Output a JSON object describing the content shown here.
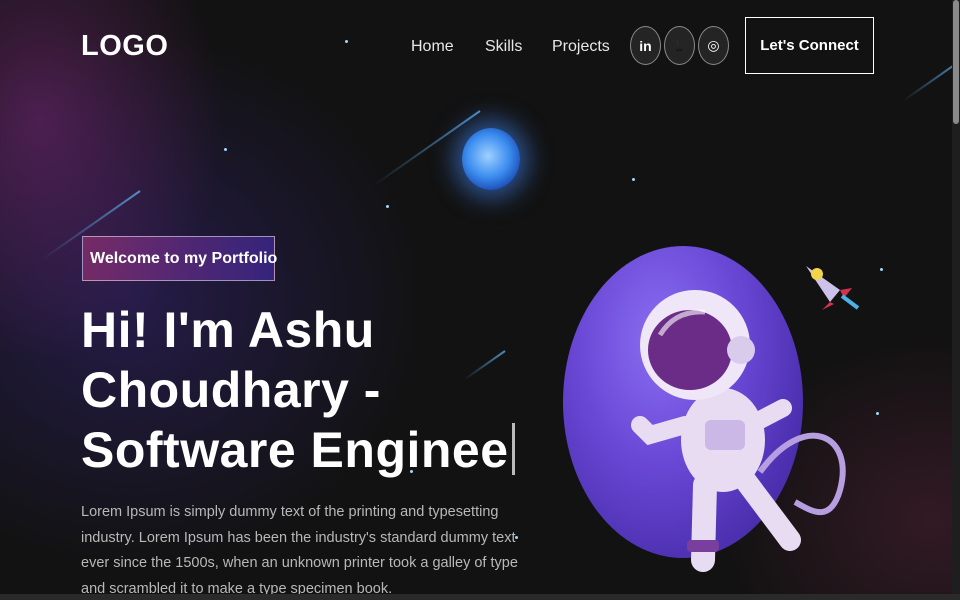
{
  "nav": {
    "logo": "LOGO",
    "links": [
      "Home",
      "Skills",
      "Projects"
    ],
    "socials": [
      {
        "icon": "linkedin-icon",
        "glyph": "in"
      },
      {
        "icon": "trophy-icon",
        "glyph": "🏆"
      },
      {
        "icon": "instagram-icon",
        "glyph": "◎"
      }
    ],
    "cta": "Let's Connect"
  },
  "hero": {
    "tagline": "Welcome to my Portfolio",
    "title_line1": "Hi! I'm Ashu",
    "title_line2": "Choudhary -",
    "title_line3": "Software Enginee",
    "description": "Lorem Ipsum is simply dummy text of the printing and typesetting industry. Lorem Ipsum has been the industry's standard dummy text ever since the 1500s, when an unknown printer took a galley of type and scrambled it to make a type specimen book."
  },
  "colors": {
    "accent_pink": "#aa367c",
    "accent_purple": "#4a2fbd",
    "background": "#121212"
  }
}
